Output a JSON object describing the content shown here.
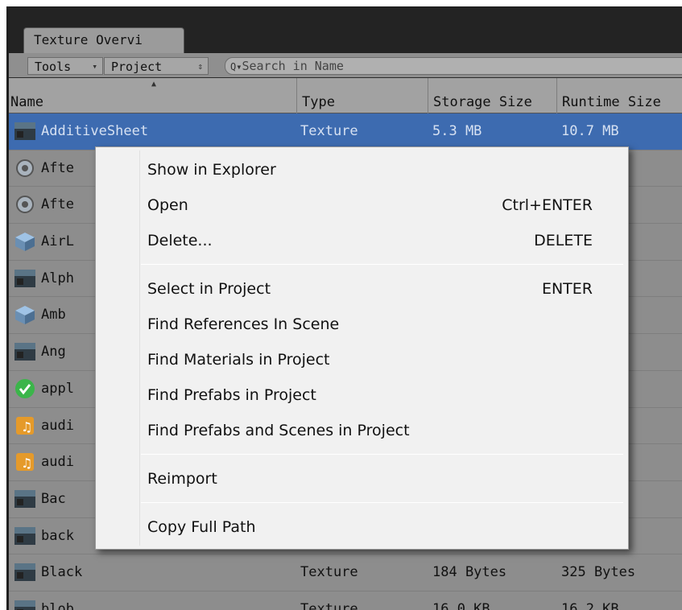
{
  "window": {
    "tab_title": "Texture Overvi"
  },
  "toolbar": {
    "tools_label": "Tools",
    "project_label": "Project",
    "search_placeholder": "Search in Name"
  },
  "columns": {
    "name": "Name",
    "type": "Type",
    "storage": "Storage Size",
    "runtime": "Runtime Size"
  },
  "rows": [
    {
      "name": "AdditiveSheet",
      "type": "Texture",
      "storage": "5.3 MB",
      "runtime": "10.7 MB",
      "icon": "texture-thumbnail-icon"
    },
    {
      "name": "Afte",
      "type": "",
      "storage": "",
      "runtime": "B",
      "icon": "gear-icon"
    },
    {
      "name": "Afte",
      "type": "",
      "storage": "",
      "runtime": "B",
      "icon": "gear-icon"
    },
    {
      "name": "AirL",
      "type": "",
      "storage": "",
      "runtime": "KB",
      "icon": "cube-icon"
    },
    {
      "name": "Alph",
      "type": "",
      "storage": "",
      "runtime": "KB",
      "icon": "texture-thumbnail-icon"
    },
    {
      "name": "Amb",
      "type": "",
      "storage": "",
      "runtime": "B",
      "icon": "cube-icon"
    },
    {
      "name": "Ang",
      "type": "",
      "storage": "",
      "runtime": "",
      "icon": "texture-thumbnail-icon"
    },
    {
      "name": "appl",
      "type": "",
      "storage": "",
      "runtime": "",
      "icon": "checkmark-icon"
    },
    {
      "name": "audi",
      "type": "",
      "storage": "",
      "runtime": "",
      "icon": "audio-icon"
    },
    {
      "name": "audi",
      "type": "",
      "storage": "",
      "runtime": "",
      "icon": "audio-icon"
    },
    {
      "name": "Bac",
      "type": "",
      "storage": "",
      "runtime": "B",
      "icon": "texture-thumbnail-icon"
    },
    {
      "name": "back",
      "type": "",
      "storage": "",
      "runtime": "B",
      "icon": "texture-thumbnail-icon"
    },
    {
      "name": "Black",
      "type": "Texture",
      "storage": "184 Bytes",
      "runtime": "325 Bytes",
      "icon": "texture-thumbnail-icon"
    },
    {
      "name": "blob",
      "type": "Texture",
      "storage": "16.0 KB",
      "runtime": "16.2 KB",
      "icon": "texture-thumbnail-icon"
    }
  ],
  "context_menu": {
    "items": [
      {
        "label": "Show in Explorer",
        "shortcut": ""
      },
      {
        "label": "Open",
        "shortcut": "Ctrl+ENTER"
      },
      {
        "label": "Delete...",
        "shortcut": "DELETE"
      },
      {
        "label": "Select in Project",
        "shortcut": "ENTER"
      },
      {
        "label": "Find References In Scene",
        "shortcut": ""
      },
      {
        "label": "Find Materials in Project",
        "shortcut": ""
      },
      {
        "label": "Find Prefabs in Project",
        "shortcut": ""
      },
      {
        "label": "Find Prefabs and Scenes in Project",
        "shortcut": ""
      },
      {
        "label": "Reimport",
        "shortcut": ""
      },
      {
        "label": "Copy Full Path",
        "shortcut": ""
      }
    ]
  },
  "colors": {
    "selection": "#3d6bb0",
    "row_bg": "#8d8d8d",
    "menu_bg": "#f1f1f1"
  }
}
